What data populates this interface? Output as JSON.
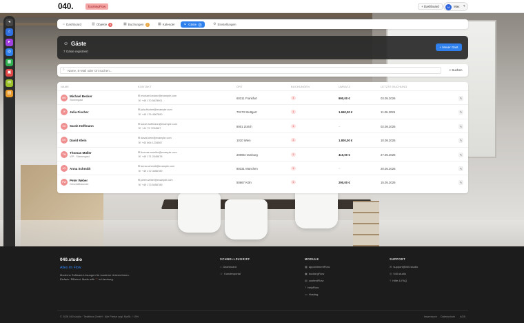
{
  "header": {
    "logo": "040.",
    "app_badge": "bookingFlow",
    "dashboard_label": "+ Dashboard",
    "user_initials": "M",
    "user_name": "Max"
  },
  "tabs": [
    {
      "label": "Dashboard",
      "icon": "home-icon",
      "count": ""
    },
    {
      "label": "Objekte",
      "icon": "building-icon",
      "count": "4",
      "count_color": "#e66060"
    },
    {
      "label": "Buchungen",
      "icon": "calendar-icon",
      "count": "2",
      "count_color": "#e8a33a"
    },
    {
      "label": "Kalender",
      "icon": "calendar-icon",
      "count": ""
    },
    {
      "label": "Gäste",
      "icon": "users-icon",
      "count": "7",
      "active": true
    },
    {
      "label": "Einstellungen",
      "icon": "gear-icon",
      "count": ""
    }
  ],
  "page": {
    "title": "Gäste",
    "subtitle": "7 Gäste registriert",
    "new_guest_label": "+ Neuer Gast"
  },
  "search": {
    "placeholder": "Name, E-Mail oder Ort suchen...",
    "button": "Suchen"
  },
  "table": {
    "headers": [
      "NAME",
      "KONTAKT",
      "ORT",
      "BUCHUNGEN",
      "UMSATZ",
      "LETZTE BUCHUNG"
    ],
    "rows": [
      {
        "initials": "MB",
        "name": "Michael Becker",
        "tag": "Stammgast",
        "email": "michael.becker@example.com",
        "phone": "+49 170 5678901",
        "city": "60311 Frankfurt",
        "bookings": "1",
        "revenue": "990,00 €",
        "last": "03.05.2026"
      },
      {
        "initials": "JF",
        "name": "Julia Fischer",
        "tag": "",
        "email": "julia.fischer@example.com",
        "phone": "+49 176 4567890",
        "city": "70173 Stuttgart",
        "bookings": "1",
        "revenue": "1.650,00 €",
        "last": "11.06.2026"
      },
      {
        "initials": "SH",
        "name": "Sarah Hoffmann",
        "tag": "",
        "email": "sarah.hoffmann@example.com",
        "phone": "+41 79 7234567",
        "city": "8001 Zürich",
        "bookings": "1",
        "revenue": "–",
        "last": "02.08.2026"
      },
      {
        "initials": "DK",
        "name": "David Klein",
        "tag": "",
        "email": "david.klein@example.com",
        "phone": "+43 664 1234567",
        "city": "1010 Wien",
        "bookings": "1",
        "revenue": "1.800,00 €",
        "last": "10.08.2026"
      },
      {
        "initials": "TM",
        "name": "Thomas Müller",
        "tag": "VIP · Stammgast",
        "email": "thomas.mueller@example.com",
        "phone": "+49 171 2345678",
        "city": "20095 Hamburg",
        "bookings": "1",
        "revenue": "410,00 €",
        "last": "27.05.2026"
      },
      {
        "initials": "AS",
        "name": "Anna Schmidt",
        "tag": "",
        "email": "anna.schmidt@example.com",
        "phone": "+49 172 3456789",
        "city": "80331 München",
        "bookings": "1",
        "revenue": "–",
        "last": "20.05.2026"
      },
      {
        "initials": "PW",
        "name": "Peter Weber",
        "tag": "Geschäftskunde",
        "email": "peter.weber@example.com",
        "phone": "+49 173 5456789",
        "city": "50667 Köln",
        "bookings": "1",
        "revenue": "290,00 €",
        "last": "15.05.2026"
      }
    ]
  },
  "footer": {
    "brand": "040.studio",
    "slogan": "Alles im Flow",
    "desc_line1": "Moderne Software-Lösungen für moderne Unternehmen.",
    "desc_line2_a": "Einfach. Effizient. Made with",
    "desc_heart": "♡",
    "desc_line2_b": "in Hamburg.",
    "col_quick": {
      "title": "SCHNELLZUGRIFF",
      "links": [
        "Dashboard",
        "Kundenportal"
      ]
    },
    "col_modules": {
      "title": "MODULE",
      "links": [
        "appointmentFlow",
        "bookingFlow",
        "contentFlow",
        "helpFlow",
        "Hosting"
      ]
    },
    "col_support": {
      "title": "SUPPORT",
      "links": [
        "support@040.studio",
        "040.studio",
        "Hilfe & FAQ"
      ]
    },
    "copyright": "© 2026 040.studio · Testfirma GmbH · Alle Preise zzgl. MwSt. / 19%",
    "bottom_links": [
      "Impressum",
      "Datenschutz",
      "AGB"
    ]
  },
  "dock": [
    {
      "icon": "collapse-icon",
      "color": "#444444",
      "glyph": "◂"
    },
    {
      "icon": "home-icon",
      "color": "#2f6fe0",
      "glyph": "⌂"
    },
    {
      "icon": "video-icon",
      "color": "#a040e0",
      "glyph": "▸"
    },
    {
      "icon": "globe-icon",
      "color": "#2f80ed",
      "glyph": "◎"
    },
    {
      "icon": "calendar-icon",
      "color": "#30b050",
      "glyph": "▦"
    },
    {
      "icon": "booking-icon",
      "color": "#e04848",
      "glyph": "▣"
    },
    {
      "icon": "mail-icon",
      "color": "#9bc02a",
      "glyph": "✉"
    },
    {
      "icon": "file-icon",
      "color": "#e89a2a",
      "glyph": "▤"
    },
    {
      "icon": "settings-icon",
      "color": "#8a50d0",
      "glyph": "◍"
    },
    {
      "icon": "add-icon",
      "color": "#30b050",
      "glyph": "+"
    },
    {
      "icon": "help-icon",
      "color": "#2f80ed",
      "glyph": "?"
    }
  ]
}
